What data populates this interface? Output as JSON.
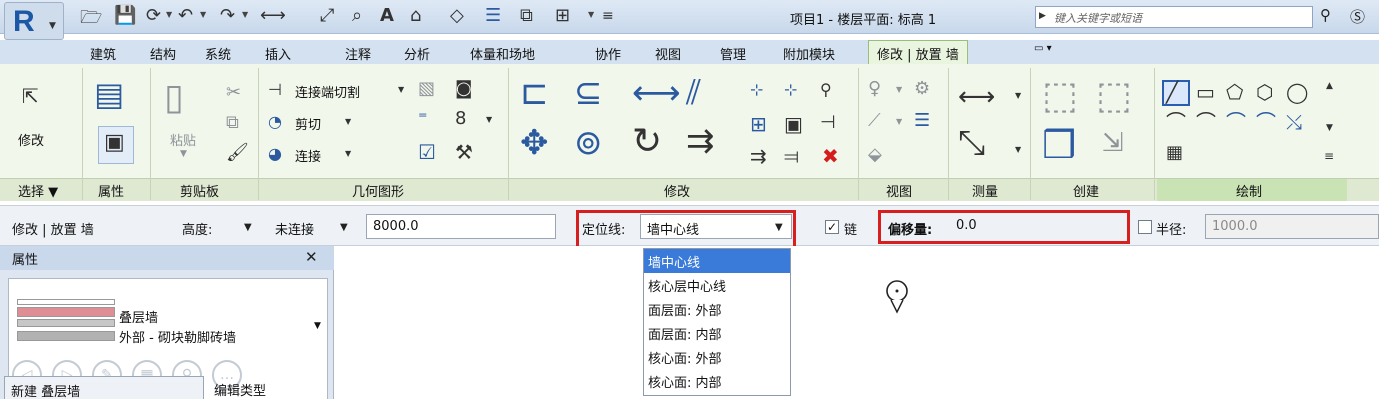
{
  "window": {
    "title": "项目1 - 楼层平面: 标高 1",
    "search_placeholder": "键入关键字或短语"
  },
  "app_button": {
    "letter": "R"
  },
  "tabs": [
    {
      "label": "建筑"
    },
    {
      "label": "结构"
    },
    {
      "label": "系统"
    },
    {
      "label": "插入"
    },
    {
      "label": "注释"
    },
    {
      "label": "分析"
    },
    {
      "label": "体量和场地"
    },
    {
      "label": "协作"
    },
    {
      "label": "视图"
    },
    {
      "label": "管理"
    },
    {
      "label": "附加模块"
    },
    {
      "label": "修改 | 放置 墙"
    }
  ],
  "ribbon": {
    "select_panel": {
      "button": "修改",
      "label": "选择 ▼"
    },
    "properties_panel": {
      "label": "属性"
    },
    "clipboard_panel": {
      "paste": "粘贴",
      "label": "剪贴板"
    },
    "geometry_panel": {
      "cope": "连接端切割",
      "cut": "剪切",
      "join": "连接",
      "label": "几何图形"
    },
    "modify_panel": {
      "label": "修改"
    },
    "view_panel": {
      "label": "视图"
    },
    "measure_panel": {
      "label": "测量"
    },
    "create_panel": {
      "label": "创建"
    },
    "draw_panel": {
      "label": "绘制"
    }
  },
  "options_bar": {
    "context": "修改 | 放置 墙",
    "height_label": "高度:",
    "height_option": "未连接",
    "height_value": "8000.0",
    "location_label": "定位线:",
    "location_value": "墙中心线",
    "chain_label": "链",
    "chain_checked": true,
    "offset_label": "偏移量:",
    "offset_value": "0.0",
    "radius_label": "半径:",
    "radius_checked": false,
    "radius_value": "1000.0"
  },
  "location_line_options": [
    {
      "label": "墙中心线",
      "selected": true
    },
    {
      "label": "核心层中心线",
      "selected": false
    },
    {
      "label": "面层面: 外部",
      "selected": false
    },
    {
      "label": "面层面: 内部",
      "selected": false
    },
    {
      "label": "核心面: 外部",
      "selected": false
    },
    {
      "label": "核心面: 内部",
      "selected": false
    }
  ],
  "properties": {
    "title": "属性",
    "type_family": "叠层墙",
    "type_name": "外部 - 砌块勒脚砖墙",
    "new_type": "新建 叠层墙",
    "edit_type": "编辑类型"
  },
  "colors": {
    "highlight_box": "#d81f1f",
    "selected_item": "#3a7ad8",
    "active_tab": "#eaf5e0"
  }
}
